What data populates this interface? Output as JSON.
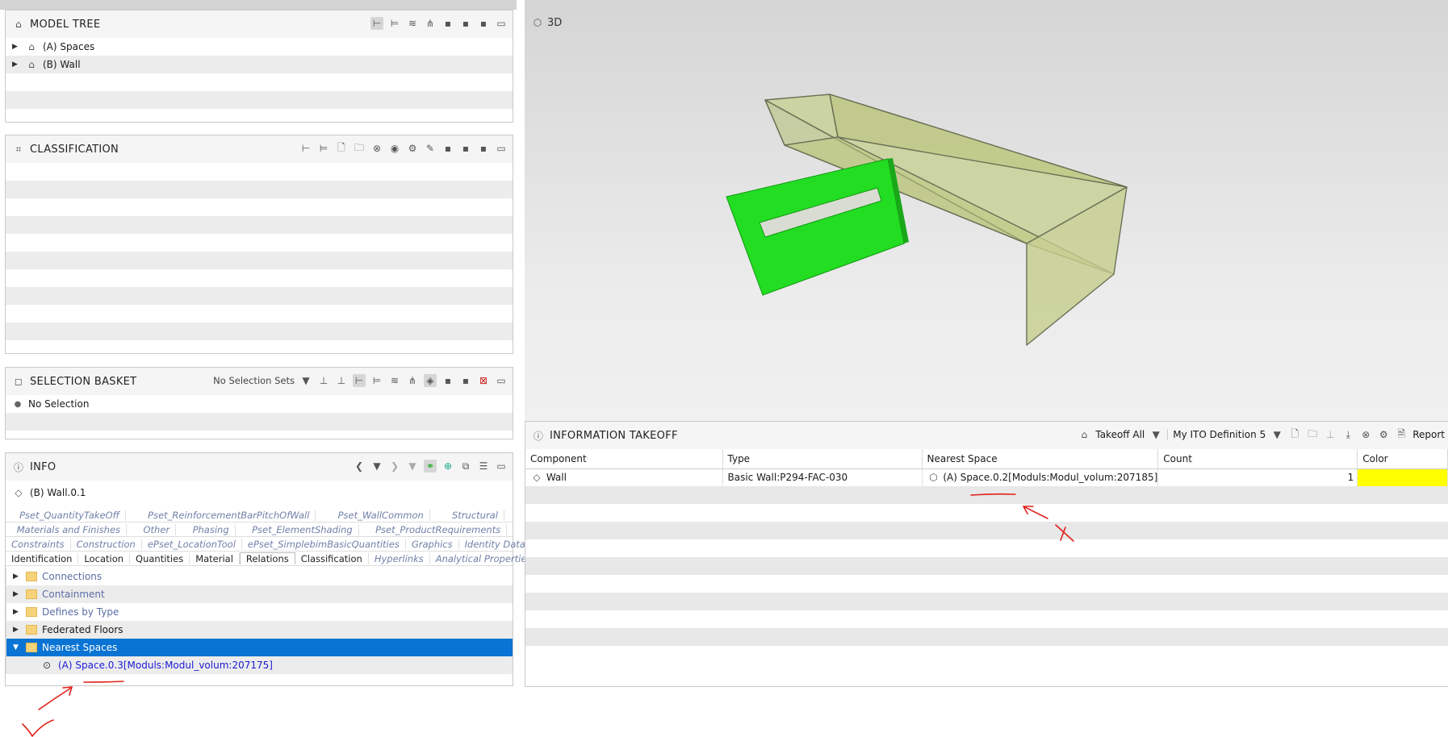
{
  "model_tree": {
    "title": "MODEL TREE",
    "items": [
      {
        "label": "(A) Spaces"
      },
      {
        "label": "(B) Wall"
      }
    ]
  },
  "classification": {
    "title": "CLASSIFICATION"
  },
  "selection_basket": {
    "title": "SELECTION BASKET",
    "sets_label": "No Selection Sets",
    "empty_label": "No Selection"
  },
  "view3d": {
    "title": "3D"
  },
  "info": {
    "title": "INFO",
    "object_label": "(B) Wall.0.1",
    "tab_rows": [
      [
        "Pset_QuantityTakeOff",
        "Pset_ReinforcementBarPitchOfWall",
        "Pset_WallCommon",
        "Structural"
      ],
      [
        "Materials and Finishes",
        "Other",
        "Phasing",
        "Pset_ElementShading",
        "Pset_ProductRequirements"
      ],
      [
        "Constraints",
        "Construction",
        "ePset_LocationTool",
        "ePset_SimplebimBasicQuantities",
        "Graphics",
        "Identity Data"
      ],
      [
        "Identification",
        "Location",
        "Quantities",
        "Material",
        "Relations",
        "Classification",
        "Hyperlinks",
        "Analytical Properties"
      ]
    ],
    "tree": {
      "connections": "Connections",
      "containment": "Containment",
      "defines_by_type": "Defines by Type",
      "federated_floors": "Federated Floors",
      "nearest_spaces": "Nearest Spaces",
      "nearest_child": "(A) Space.0.3[Moduls:Modul_volum:207175]"
    }
  },
  "takeoff": {
    "title": "INFORMATION TAKEOFF",
    "takeoff_all": "Takeoff All",
    "definition": "My ITO Definition 5",
    "report": "Report",
    "columns": [
      "Component",
      "Type",
      "Nearest Space",
      "Count",
      "Color"
    ],
    "row": {
      "component": "Wall",
      "type": "Basic Wall:P294-FAC-030",
      "nearest_space": "(A) Space.0.2[Moduls:Modul_volum:207185]",
      "count": "1",
      "color_hex": "#ffff00"
    }
  },
  "colors": {
    "selection_blue": "#0a74d4",
    "wall_green": "#22dd22",
    "space_olive": "#c2cc8a",
    "annotation_red": "#e0201a"
  }
}
